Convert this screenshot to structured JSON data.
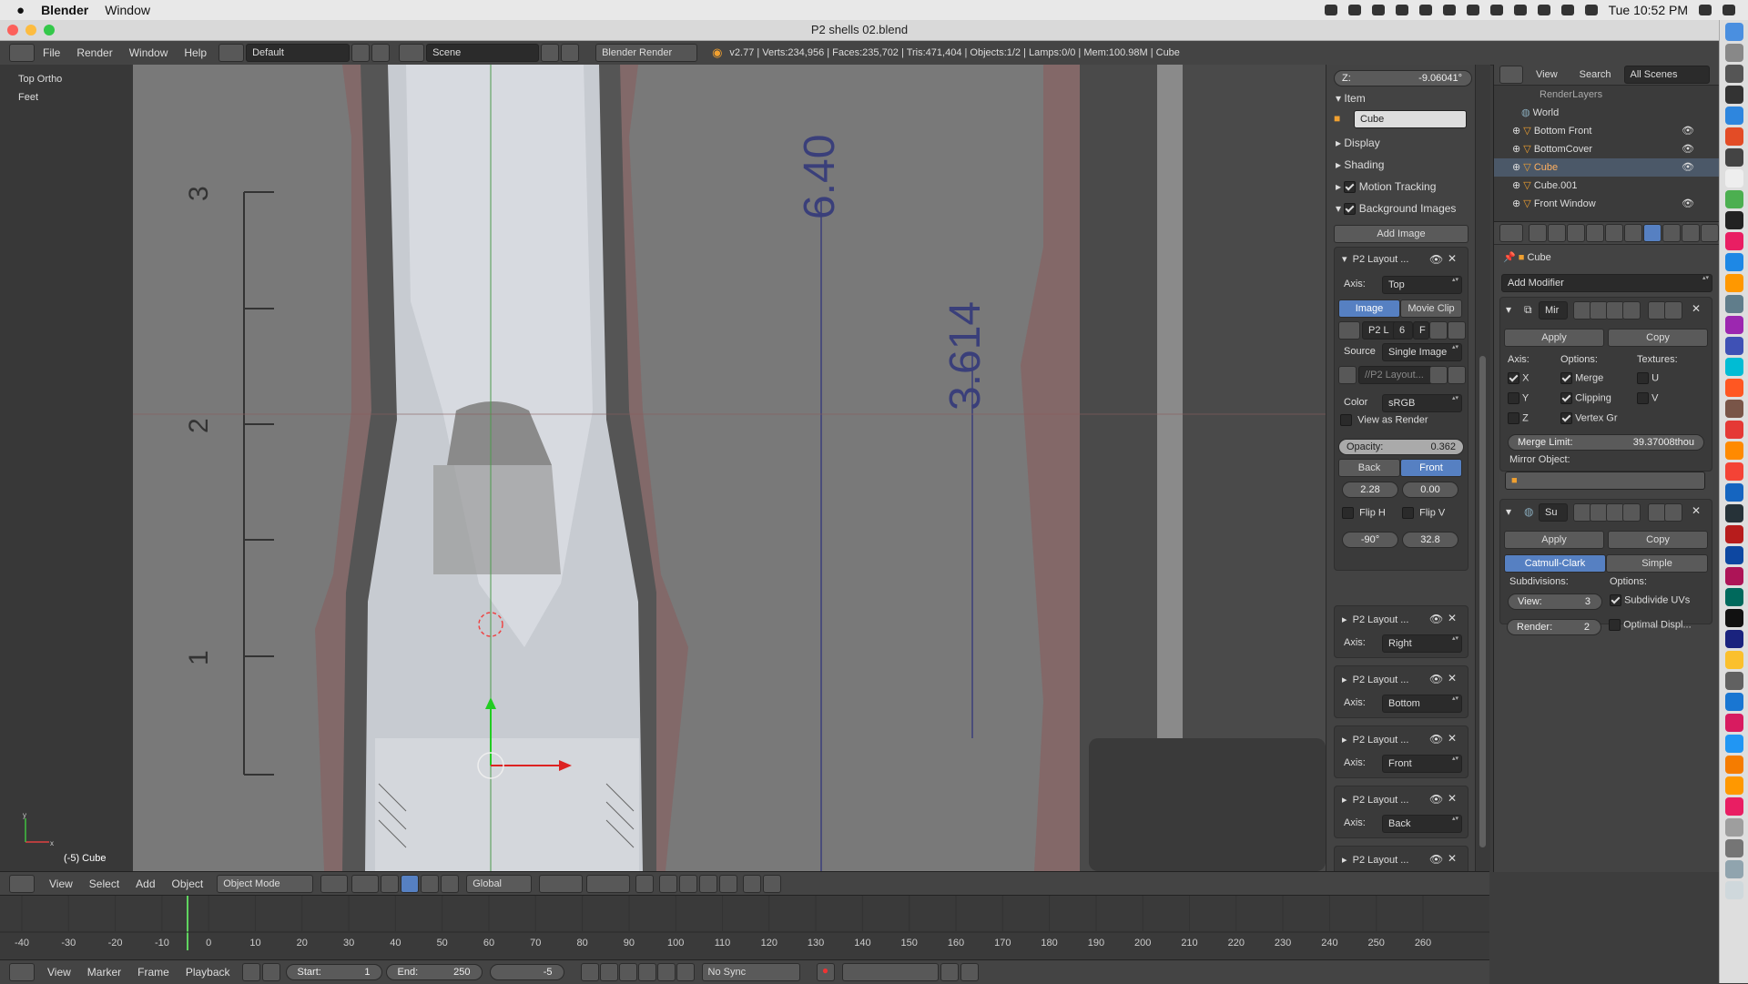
{
  "menubar": {
    "app_name": "Blender",
    "window_menu": "Window",
    "clock": "Tue 10:52 PM"
  },
  "window": {
    "title": "P2 shells 02.blend"
  },
  "info_header": {
    "menus": [
      "File",
      "Render",
      "Window",
      "Help"
    ],
    "layout": "Default",
    "scene": "Scene",
    "engine": "Blender Render",
    "stats": "v2.77 | Verts:234,956 | Faces:235,702 | Tris:471,404 | Objects:1/2 | Lamps:0/0 | Mem:100.98M | Cube"
  },
  "viewport": {
    "view_name": "Top Ortho",
    "units": "Feet",
    "object_label": "(-5) Cube",
    "ruler_labels": [
      "3",
      "2",
      "1"
    ],
    "dim_label_1": "6.40",
    "dim_label_2": "3.614",
    "axis_x": "x",
    "axis_y": "y"
  },
  "npanel": {
    "z_label": "Z:",
    "z_value": "-9.06041°",
    "item_header": "Item",
    "item_name": "Cube",
    "display": "Display",
    "shading": "Shading",
    "motion_tracking": "Motion Tracking",
    "background_images": "Background Images",
    "add_image": "Add Image",
    "bg_first": {
      "name": "P2 Layout ...",
      "axis_label": "Axis:",
      "axis": "Top",
      "tab_image": "Image",
      "tab_movie": "Movie Clip",
      "img_name": "P2 L",
      "img_users": "6",
      "img_f": "F",
      "source_label": "Source",
      "source": "Single Image",
      "path": "//P2 Layout...",
      "color_label": "Color",
      "color": "sRGB",
      "view_as_render": "View as Render",
      "opacity_label": "Opacity:",
      "opacity": "0.362",
      "back": "Back",
      "front": "Front",
      "offset_x": "2.28",
      "offset_y": "0.00",
      "flip_h": "Flip H",
      "flip_v": "Flip V",
      "rotation": "-90°",
      "size": "32.8"
    },
    "bg_others": [
      {
        "name": "P2 Layout ...",
        "axis_label": "Axis:",
        "axis": "Right"
      },
      {
        "name": "P2 Layout ...",
        "axis_label": "Axis:",
        "axis": "Bottom"
      },
      {
        "name": "P2 Layout ...",
        "axis_label": "Axis:",
        "axis": "Front"
      },
      {
        "name": "P2 Layout ...",
        "axis_label": "Axis:",
        "axis": "Back"
      },
      {
        "name": "P2 Layout ...",
        "axis_label": "",
        "axis": ""
      }
    ]
  },
  "outliner": {
    "menus": [
      "View",
      "Search"
    ],
    "filter": "All Scenes",
    "items": [
      {
        "label": "RenderLayers"
      },
      {
        "label": "World"
      },
      {
        "label": "Bottom Front"
      },
      {
        "label": "BottomCover"
      },
      {
        "label": "Cube"
      },
      {
        "label": "Cube.001"
      },
      {
        "label": "Front Window"
      }
    ]
  },
  "properties": {
    "object": "Cube",
    "add_modifier": "Add Modifier",
    "mirror": {
      "name": "Mir",
      "apply": "Apply",
      "copy": "Copy",
      "axis_label": "Axis:",
      "options_label": "Options:",
      "textures_label": "Textures:",
      "x": "X",
      "y": "Y",
      "z": "Z",
      "merge": "Merge",
      "clipping": "Clipping",
      "vertex_groups": "Vertex Gr",
      "u": "U",
      "v": "V",
      "merge_limit_label": "Merge Limit:",
      "merge_limit": "39.37008thou",
      "mirror_object_label": "Mirror Object:"
    },
    "subsurf": {
      "name": "Su",
      "apply": "Apply",
      "copy": "Copy",
      "catmull": "Catmull-Clark",
      "simple": "Simple",
      "subdivisions_label": "Subdivisions:",
      "options_label": "Options:",
      "view_label": "View:",
      "view": "3",
      "render_label": "Render:",
      "render": "2",
      "subdivide_uvs": "Subdivide UVs",
      "optimal_display": "Optimal Displ..."
    }
  },
  "view3d_header": {
    "menus": [
      "View",
      "Select",
      "Add",
      "Object"
    ],
    "mode": "Object Mode",
    "orientation": "Global"
  },
  "timeline": {
    "ticks": [
      "-40",
      "-30",
      "-20",
      "-10",
      "0",
      "10",
      "20",
      "30",
      "40",
      "50",
      "60",
      "70",
      "80",
      "90",
      "100",
      "110",
      "120",
      "130",
      "140",
      "150",
      "160",
      "170",
      "180",
      "190",
      "200",
      "210",
      "220",
      "230",
      "240",
      "250",
      "260"
    ],
    "menus": [
      "View",
      "Marker",
      "Frame",
      "Playback"
    ],
    "start_label": "Start:",
    "start": "1",
    "end_label": "End:",
    "end": "250",
    "current": "-5",
    "sync": "No Sync"
  }
}
